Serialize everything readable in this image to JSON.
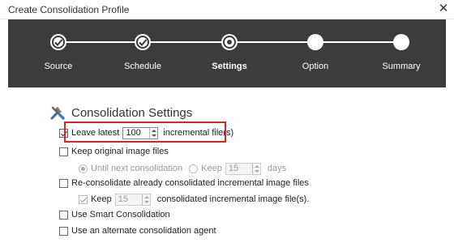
{
  "window": {
    "title": "Create Consolidation Profile",
    "close_glyph": "✕"
  },
  "steps": [
    {
      "label": "Source",
      "state": "done"
    },
    {
      "label": "Schedule",
      "state": "done"
    },
    {
      "label": "Settings",
      "state": "current"
    },
    {
      "label": "Option",
      "state": "pending"
    },
    {
      "label": "Summary",
      "state": "pending"
    }
  ],
  "section": {
    "title": "Consolidation Settings",
    "icon": "tools-icon"
  },
  "options": {
    "leave_latest": {
      "label_before": "Leave latest",
      "value": "100",
      "label_after": "incremental file(s)",
      "checked": true
    },
    "keep_original": {
      "label": "Keep original image files",
      "checked": false
    },
    "until_next": {
      "label": "Until next consolidation",
      "checked": true
    },
    "keep_days": {
      "label_before": "Keep",
      "value": "15",
      "label_after": "days",
      "checked": false
    },
    "reconsolidate": {
      "label": "Re-consolidate already consolidated incremental image files",
      "checked": false
    },
    "keep_incremental": {
      "label_before": "Keep",
      "value": "15",
      "label_after": "consolidated incremental image file(s).",
      "checked": true
    },
    "smart": {
      "label": "Use Smart Consolidation",
      "checked": false
    },
    "alt_agent": {
      "label": "Use an alternate consolidation agent",
      "checked": false
    }
  },
  "colors": {
    "header_bg": "#3c3c3c",
    "highlight": "#d9232d"
  }
}
